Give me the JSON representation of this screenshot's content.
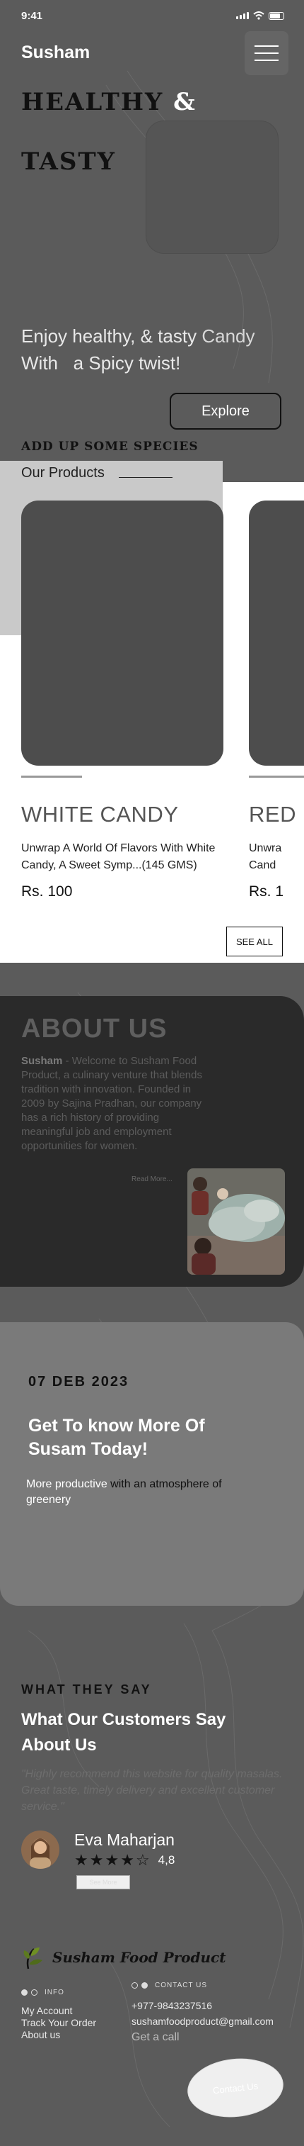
{
  "status_bar": {
    "time": "9:41"
  },
  "header": {
    "brand": "Susham"
  },
  "hero": {
    "line1": "HEALTHY",
    "amp": "&",
    "line2": "TASTY",
    "tagline_a": "Enjoy healthy, & tasty",
    "tagline_b": "Candy",
    "tagline_c": "With",
    "tagline_d": "a Spicy twist!",
    "explore_label": "Explore",
    "species_label": "ADD UP SOME SPECIES"
  },
  "products": {
    "section_title": "Our Products",
    "see_all_label": "SEE ALL",
    "items": [
      {
        "name": "WHITE CANDY",
        "description": "Unwrap A World Of Flavors With White Candy, A Sweet Symp...(145 GMS)",
        "price": "Rs. 100"
      },
      {
        "name": "RED",
        "description": "Unwra Cand",
        "price": "Rs. 1"
      }
    ]
  },
  "about": {
    "title": "ABOUT US",
    "brand": "Susham",
    "text": " - Welcome to Susham Food Product, a culinary venture that blends tradition with innovation. Founded in 2009 by Sajina Pradhan, our company has a rich history of providing meaningful job and employment opportunities for women.",
    "read_more": "Read More..."
  },
  "event": {
    "date": "07 DEB 2023",
    "heading": "Get To know More Of Susam Today!",
    "sub_a": "More productive",
    "sub_b": "with an atmosphere of",
    "sub_c": "greenery"
  },
  "testimonials": {
    "eyebrow": "WHAT THEY SAY",
    "heading": "What Our Customers Say About Us",
    "quote": "\"Highly recommend this website for quality masalas. Great taste, timely delivery and excellent customer service.\"",
    "name": "Eva Maharjan",
    "stars": 4,
    "rating": "4,8",
    "see_more": "See More"
  },
  "footer": {
    "logo_text": "Susham Food Product",
    "info_label": "INFO",
    "contact_label": "CONTACT US",
    "links": [
      "My Account",
      "Track Your Order",
      "About us"
    ],
    "phone": "+977-9843237516",
    "email": "sushamfoodproduct@gmail.com",
    "call": "Get a call",
    "contact_button": "Contact Us"
  },
  "colors": {
    "background": "#5b5b5b",
    "dark": "#111111",
    "about_bg": "#2a2a2a",
    "event_bg": "#7a7a7a",
    "product_bg": "#ffffff"
  }
}
